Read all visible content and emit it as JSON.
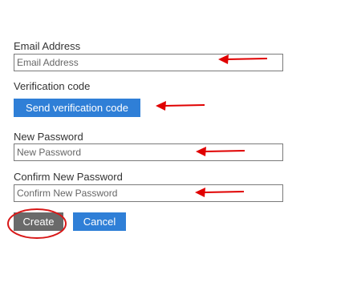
{
  "form": {
    "email": {
      "label": "Email Address",
      "placeholder": "Email Address",
      "value": ""
    },
    "verification": {
      "label": "Verification code",
      "button_label": "Send verification code"
    },
    "new_password": {
      "label": "New Password",
      "placeholder": "New Password",
      "value": ""
    },
    "confirm_password": {
      "label": "Confirm New Password",
      "placeholder": "Confirm New Password",
      "value": ""
    },
    "actions": {
      "create_label": "Create",
      "cancel_label": "Cancel"
    }
  },
  "annotations": {
    "arrow_color": "#e00000",
    "circle_color": "#d81818",
    "arrow_icon": "left-arrow-icon",
    "circle_shape": "ellipse-highlight"
  },
  "colors": {
    "primary_button": "#2f7fd7",
    "create_button": "#6a6a6a",
    "input_border": "#7a7a7a"
  }
}
